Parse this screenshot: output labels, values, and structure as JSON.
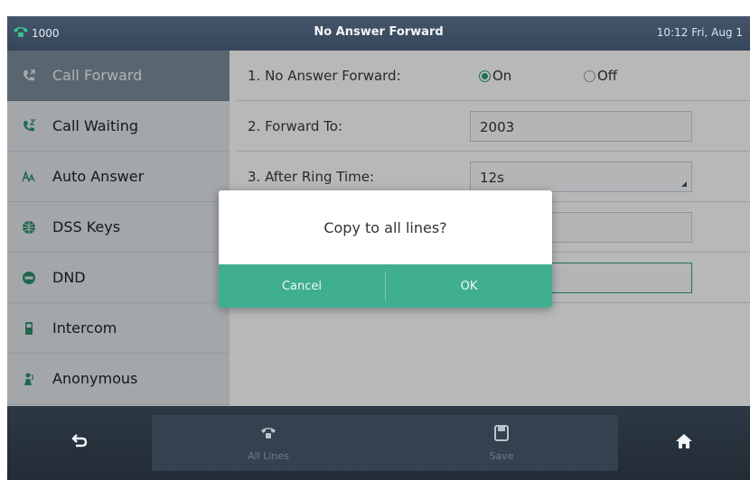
{
  "topbar": {
    "account": "1000",
    "title": "No Answer Forward",
    "datetime": "10:12 Fri, Aug 1"
  },
  "sidebar": {
    "items": [
      {
        "label": "Call Forward",
        "icon": "call-forward-icon",
        "active": true
      },
      {
        "label": "Call Waiting",
        "icon": "call-waiting-icon"
      },
      {
        "label": "Auto Answer",
        "icon": "auto-answer-icon"
      },
      {
        "label": "DSS Keys",
        "icon": "dss-keys-icon"
      },
      {
        "label": "DND",
        "icon": "dnd-icon"
      },
      {
        "label": "Intercom",
        "icon": "intercom-icon"
      },
      {
        "label": "Anonymous",
        "icon": "anonymous-icon"
      }
    ]
  },
  "settings": {
    "rows": [
      {
        "label": "1. No Answer Forward:",
        "on_label": "On",
        "off_label": "Off",
        "selected": "On"
      },
      {
        "label": "2. Forward To:",
        "value": "2003"
      },
      {
        "label": "3. After Ring Time:",
        "value": "12s"
      }
    ]
  },
  "dialog": {
    "message": "Copy to all lines?",
    "cancel_label": "Cancel",
    "ok_label": "OK"
  },
  "softkeys": {
    "back_icon": "back-icon",
    "all_lines_label": "All Lines",
    "save_label": "Save",
    "home_icon": "home-icon"
  },
  "colors": {
    "topbar": "#3e4e62",
    "sidebar_active": "#7c8e9a",
    "accent": "#3fae8e",
    "bottombar": "#27323d"
  }
}
